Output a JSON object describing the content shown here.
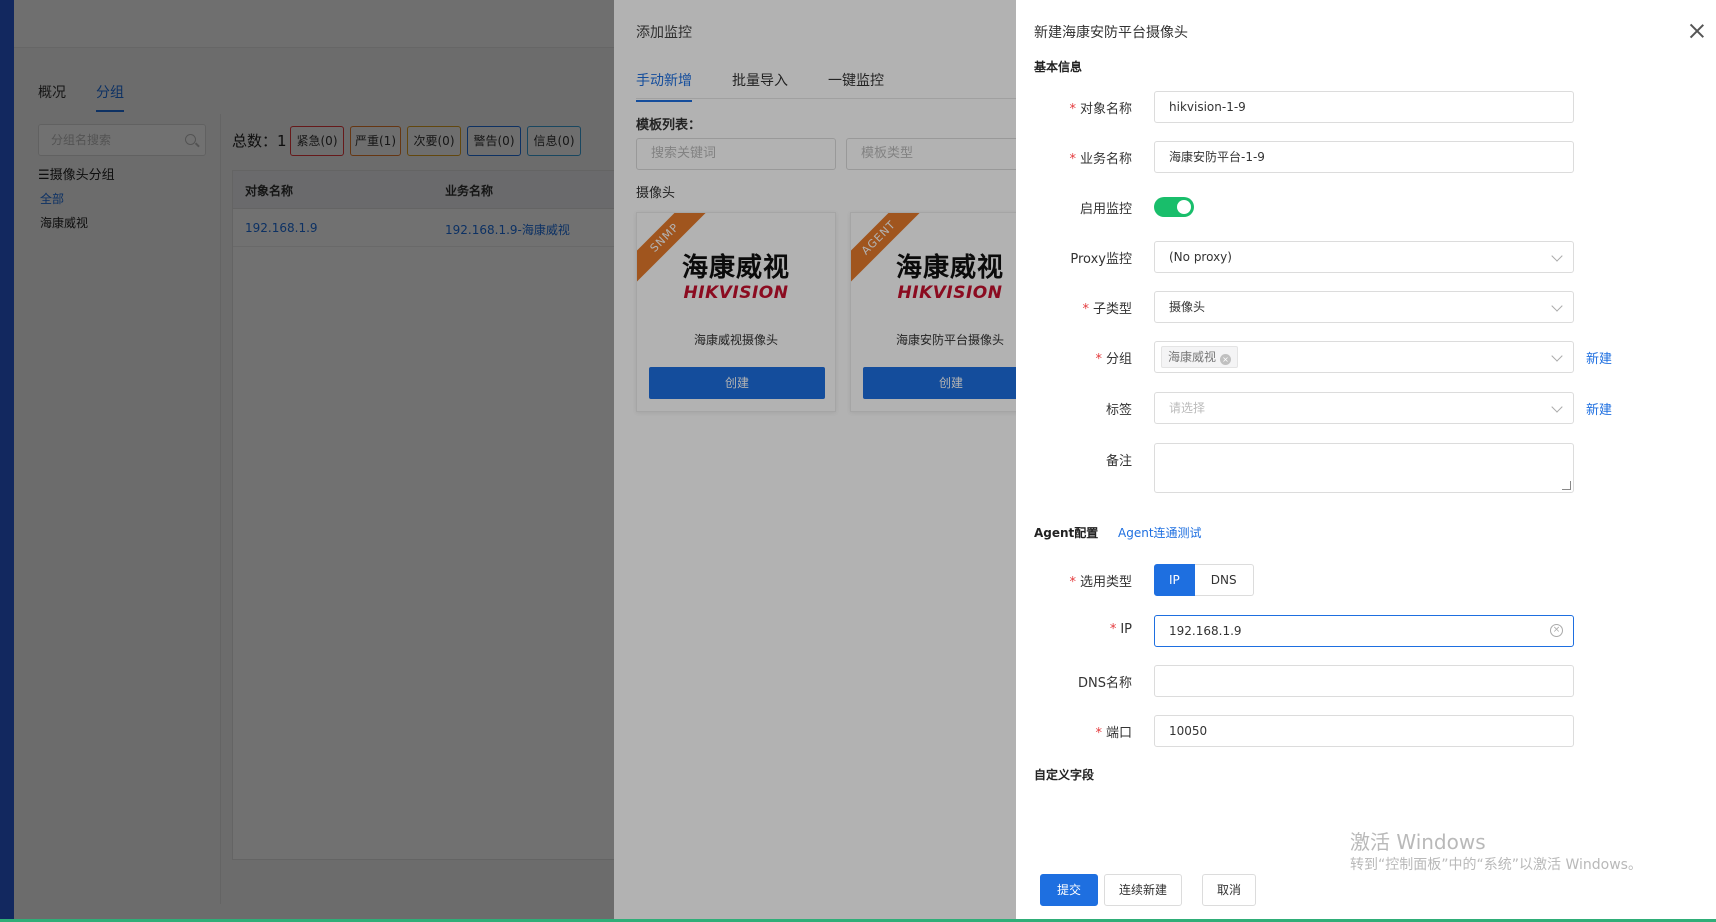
{
  "base": {
    "tabs": [
      "概况",
      "分组"
    ],
    "active_tab": "分组",
    "group_search_placeholder": "分组名搜索",
    "group_title": "☰摄像头分组",
    "group_all": "全部",
    "group_item": "海康威视",
    "total": "总数：1",
    "severity": [
      {
        "label": "紧急(0)",
        "color": "#e4393c"
      },
      {
        "label": "严重(1)",
        "color": "#e57a2b"
      },
      {
        "label": "次要(0)",
        "color": "#e0a020"
      },
      {
        "label": "警告(0)",
        "color": "#1e6fe0"
      },
      {
        "label": "信息(0)",
        "color": "#3aa0d8"
      }
    ],
    "table": {
      "headers": [
        "对象名称",
        "业务名称"
      ],
      "rows": [
        [
          "192.168.1.9",
          "192.168.1.9-海康威视"
        ]
      ]
    }
  },
  "middle": {
    "title": "添加监控",
    "tabs": [
      "手动新增",
      "批量导入",
      "一键监控"
    ],
    "template_list_label": "模板列表：",
    "search_placeholder": "搜索关键词",
    "type_placeholder": "模板类型",
    "camera_label": "摄像头",
    "cards": [
      {
        "ribbon": "SNMP",
        "logo_cn": "海康威视",
        "logo_en": "HIKVISION",
        "name": "海康威视摄像头",
        "button": "创建"
      },
      {
        "ribbon": "AGENT",
        "logo_cn": "海康威视",
        "logo_en": "HIKVISION",
        "name": "海康安防平台摄像头",
        "button": "创建"
      }
    ]
  },
  "drawer": {
    "title": "新建海康安防平台摄像头",
    "basic_info": "基本信息",
    "object_name_label": "对象名称",
    "object_name_value": "hikvision-1-9",
    "business_name_label": "业务名称",
    "business_name_value": "海康安防平台-1-9",
    "enable_label": "启用监控",
    "enable_on": true,
    "proxy_label": "Proxy监控",
    "proxy_value": "(No proxy)",
    "subtype_label": "子类型",
    "subtype_value": "摄像头",
    "group_label": "分组",
    "group_tag": "海康威视",
    "new_link": "新建",
    "tag_label": "标签",
    "tag_placeholder": "请选择",
    "remark_label": "备注",
    "agent_config": "Agent配置",
    "agent_test": "Agent连通测试",
    "addr_type_label": "选用类型",
    "addr_type_options": [
      "IP",
      "DNS"
    ],
    "addr_type_selected": "IP",
    "ip_label": "IP",
    "ip_value": "192.168.1.9",
    "dns_label": "DNS名称",
    "port_label": "端口",
    "port_value": "10050",
    "custom_fields": "自定义字段",
    "buttons": {
      "submit": "提交",
      "continue": "连续新建",
      "cancel": "取消"
    }
  },
  "watermark": {
    "line1": "激活 Windows",
    "line2": "转到“控制面板”中的“系统”以激活 Windows。"
  }
}
